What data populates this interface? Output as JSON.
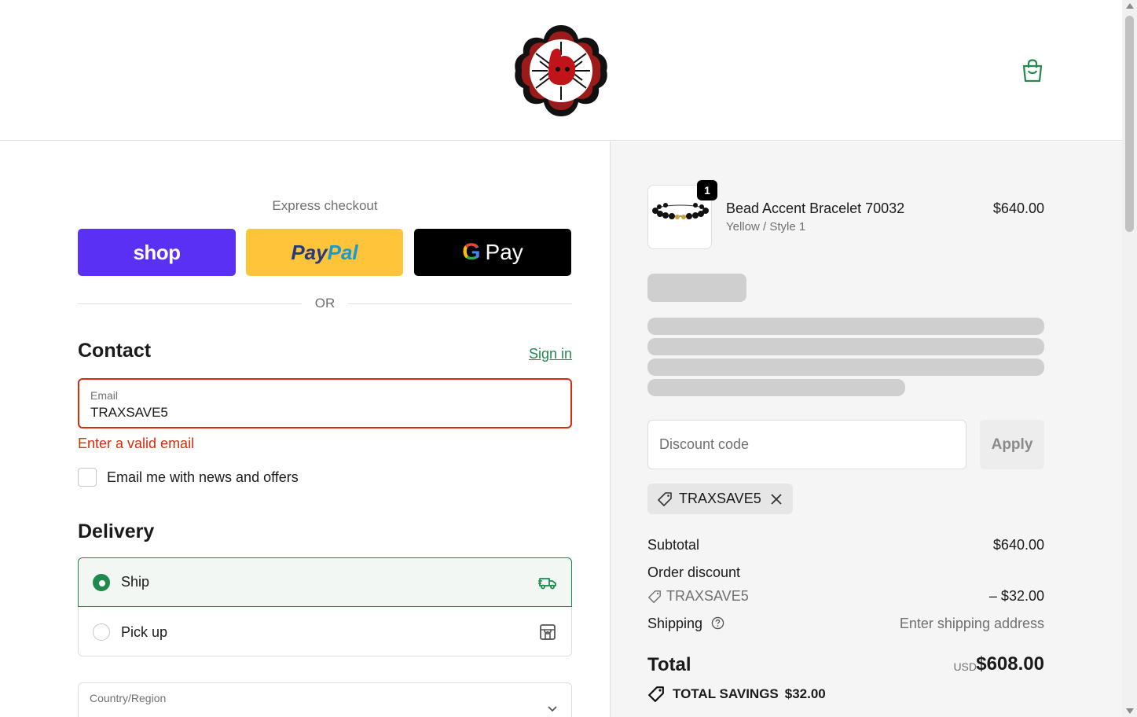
{
  "header": {
    "logo_alt": "store-logo",
    "cart_icon": "shopping-bag-icon"
  },
  "express": {
    "label": "Express checkout",
    "shop_label": "shop",
    "paypal_label_1": "Pay",
    "paypal_label_2": "Pal",
    "gpay_g": "G",
    "gpay_label": "Pay",
    "or_label": "OR"
  },
  "contact": {
    "title": "Contact",
    "sign_in": "Sign in",
    "email_label": "Email",
    "email_value": "TRAXSAVE5",
    "email_error": "Enter a valid email",
    "newsletter_label": "Email me with news and offers"
  },
  "delivery": {
    "title": "Delivery",
    "options": [
      {
        "label": "Ship",
        "selected": true,
        "icon": "truck-icon"
      },
      {
        "label": "Pick up",
        "selected": false,
        "icon": "store-icon"
      }
    ],
    "country_label": "Country/Region"
  },
  "order": {
    "item": {
      "name": "Bead Accent Bracelet 70032",
      "variant": "Yellow / Style 1",
      "price": "$640.00",
      "quantity": "1"
    },
    "discount_placeholder": "Discount code",
    "apply_label": "Apply",
    "applied_code": "TRAXSAVE5",
    "subtotal_label": "Subtotal",
    "subtotal_value": "$640.00",
    "order_discount_label": "Order discount",
    "discount_code": "TRAXSAVE5",
    "discount_value": "– $32.00",
    "shipping_label": "Shipping",
    "shipping_value": "Enter shipping address",
    "total_label": "Total",
    "currency": "USD",
    "total_value": "$608.00",
    "savings_label": "TOTAL SAVINGS",
    "savings_value": "$32.00"
  },
  "colors": {
    "accent": "#1f8a4c",
    "error": "#d72c0d",
    "shop_purple": "#5a31f4",
    "paypal_yellow": "#ffc439"
  }
}
